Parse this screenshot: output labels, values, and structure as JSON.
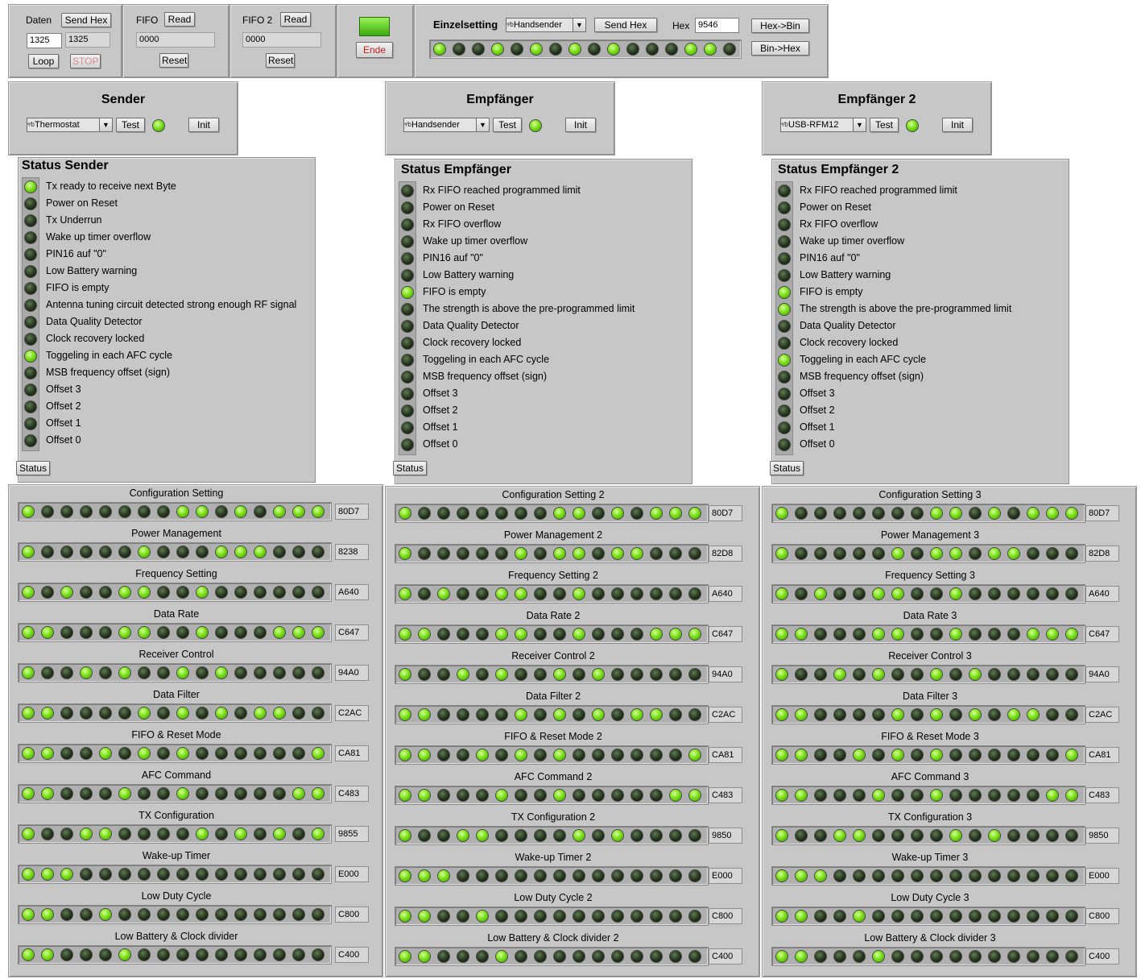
{
  "top": {
    "daten": {
      "label": "Daten",
      "send_hex": "Send Hex",
      "value_in": "1325",
      "value_out": "1325",
      "loop": "Loop",
      "stop": "STOP"
    },
    "fifo": {
      "label": "FIFO",
      "read": "Read",
      "value": "0000",
      "reset": "Reset"
    },
    "fifo2": {
      "label": "FIFO 2",
      "read": "Read",
      "value": "0000",
      "reset": "Reset"
    },
    "ende": "Ende",
    "einzel": {
      "label": "Einzelsetting",
      "combo": "Handsender",
      "send_hex": "Send Hex",
      "hex_label": "Hex",
      "hex_value": "9546",
      "hex_to_bin": "Hex->Bin",
      "bin_to_hex": "Bin->Hex",
      "leds": [
        1,
        0,
        0,
        1,
        0,
        1,
        0,
        1,
        0,
        1,
        0,
        0,
        0,
        1,
        1,
        0
      ]
    }
  },
  "devices": [
    {
      "title": "Sender",
      "combo": "Thermostat",
      "test": "Test",
      "init": "Init",
      "status_title": "Status Sender",
      "status_button": "Status",
      "indicators": [
        {
          "label": "Tx ready to receive next Byte",
          "on": true
        },
        {
          "label": "Power on Reset",
          "on": false
        },
        {
          "label": "Tx Underrun",
          "on": false
        },
        {
          "label": "Wake up timer overflow",
          "on": false
        },
        {
          "label": "PIN16 auf \"0\"",
          "on": false
        },
        {
          "label": "Low Battery warning",
          "on": false
        },
        {
          "label": "FIFO is empty",
          "on": false
        },
        {
          "label": "Antenna tuning circuit detected strong enough RF signal",
          "on": false
        },
        {
          "label": "Data Quality Detector",
          "on": false
        },
        {
          "label": "Clock recovery locked",
          "on": false
        },
        {
          "label": "Toggeling in each AFC cycle",
          "on": true
        },
        {
          "label": "MSB frequency offset (sign)",
          "on": false
        },
        {
          "label": "Offset 3",
          "on": false
        },
        {
          "label": "Offset 2",
          "on": false
        },
        {
          "label": "Offset 1",
          "on": false
        },
        {
          "label": "Offset 0",
          "on": false
        }
      ],
      "configs": [
        {
          "title": "Configuration Setting",
          "hex": "80D7",
          "bits": [
            1,
            0,
            0,
            0,
            0,
            0,
            0,
            0,
            1,
            1,
            0,
            1,
            0,
            1,
            1,
            1
          ]
        },
        {
          "title": "Power Management",
          "hex": "8238",
          "bits": [
            1,
            0,
            0,
            0,
            0,
            0,
            1,
            0,
            0,
            0,
            1,
            1,
            1,
            0,
            0,
            0
          ]
        },
        {
          "title": "Frequency Setting",
          "hex": "A640",
          "bits": [
            1,
            0,
            1,
            0,
            0,
            1,
            1,
            0,
            0,
            1,
            0,
            0,
            0,
            0,
            0,
            0
          ]
        },
        {
          "title": "Data Rate",
          "hex": "C647",
          "bits": [
            1,
            1,
            0,
            0,
            0,
            1,
            1,
            0,
            0,
            1,
            0,
            0,
            0,
            1,
            1,
            1
          ]
        },
        {
          "title": "Receiver Control",
          "hex": "94A0",
          "bits": [
            1,
            0,
            0,
            1,
            0,
            1,
            0,
            0,
            1,
            0,
            1,
            0,
            0,
            0,
            0,
            0
          ]
        },
        {
          "title": "Data Filter",
          "hex": "C2AC",
          "bits": [
            1,
            1,
            0,
            0,
            0,
            0,
            1,
            0,
            1,
            0,
            1,
            0,
            1,
            1,
            0,
            0
          ]
        },
        {
          "title": "FIFO & Reset Mode",
          "hex": "CA81",
          "bits": [
            1,
            1,
            0,
            0,
            1,
            0,
            1,
            0,
            1,
            0,
            0,
            0,
            0,
            0,
            0,
            1
          ]
        },
        {
          "title": "AFC Command",
          "hex": "C483",
          "bits": [
            1,
            1,
            0,
            0,
            0,
            1,
            0,
            0,
            1,
            0,
            0,
            0,
            0,
            0,
            1,
            1
          ]
        },
        {
          "title": "TX Configuration",
          "hex": "9855",
          "bits": [
            1,
            0,
            0,
            1,
            1,
            0,
            0,
            0,
            0,
            1,
            0,
            1,
            0,
            1,
            0,
            1
          ]
        },
        {
          "title": "Wake-up Timer",
          "hex": "E000",
          "bits": [
            1,
            1,
            1,
            0,
            0,
            0,
            0,
            0,
            0,
            0,
            0,
            0,
            0,
            0,
            0,
            0
          ]
        },
        {
          "title": "Low Duty Cycle",
          "hex": "C800",
          "bits": [
            1,
            1,
            0,
            0,
            1,
            0,
            0,
            0,
            0,
            0,
            0,
            0,
            0,
            0,
            0,
            0
          ]
        },
        {
          "title": "Low Battery & Clock divider",
          "hex": "C400",
          "bits": [
            1,
            1,
            0,
            0,
            0,
            1,
            0,
            0,
            0,
            0,
            0,
            0,
            0,
            0,
            0,
            0
          ]
        }
      ]
    },
    {
      "title": "Empfänger",
      "combo": "Handsender",
      "test": "Test",
      "init": "Init",
      "status_title": "Status Empfänger",
      "status_button": "Status",
      "indicators": [
        {
          "label": "Rx FIFO reached programmed limit",
          "on": false
        },
        {
          "label": "Power on Reset",
          "on": false
        },
        {
          "label": "Rx FIFO overflow",
          "on": false
        },
        {
          "label": "Wake up timer overflow",
          "on": false
        },
        {
          "label": "PIN16 auf \"0\"",
          "on": false
        },
        {
          "label": "Low Battery warning",
          "on": false
        },
        {
          "label": "FIFO is empty",
          "on": true
        },
        {
          "label": "The strength is above the pre-programmed limit",
          "on": false
        },
        {
          "label": "Data Quality Detector",
          "on": false
        },
        {
          "label": "Clock recovery locked",
          "on": false
        },
        {
          "label": "Toggeling in each AFC cycle",
          "on": false
        },
        {
          "label": "MSB frequency offset (sign)",
          "on": false
        },
        {
          "label": "Offset 3",
          "on": false
        },
        {
          "label": "Offset 2",
          "on": false
        },
        {
          "label": "Offset 1",
          "on": false
        },
        {
          "label": "Offset 0",
          "on": false
        }
      ],
      "configs": [
        {
          "title": "Configuration Setting 2",
          "hex": "80D7",
          "bits": [
            1,
            0,
            0,
            0,
            0,
            0,
            0,
            0,
            1,
            1,
            0,
            1,
            0,
            1,
            1,
            1
          ]
        },
        {
          "title": "Power Management 2",
          "hex": "82D8",
          "bits": [
            1,
            0,
            0,
            0,
            0,
            0,
            1,
            0,
            1,
            1,
            0,
            1,
            1,
            0,
            0,
            0
          ]
        },
        {
          "title": "Frequency Setting 2",
          "hex": "A640",
          "bits": [
            1,
            0,
            1,
            0,
            0,
            1,
            1,
            0,
            0,
            1,
            0,
            0,
            0,
            0,
            0,
            0
          ]
        },
        {
          "title": "Data Rate 2",
          "hex": "C647",
          "bits": [
            1,
            1,
            0,
            0,
            0,
            1,
            1,
            0,
            0,
            1,
            0,
            0,
            0,
            1,
            1,
            1
          ]
        },
        {
          "title": "Receiver Control 2",
          "hex": "94A0",
          "bits": [
            1,
            0,
            0,
            1,
            0,
            1,
            0,
            0,
            1,
            0,
            1,
            0,
            0,
            0,
            0,
            0
          ]
        },
        {
          "title": "Data Filter 2",
          "hex": "C2AC",
          "bits": [
            1,
            1,
            0,
            0,
            0,
            0,
            1,
            0,
            1,
            0,
            1,
            0,
            1,
            1,
            0,
            0
          ]
        },
        {
          "title": "FIFO & Reset Mode 2",
          "hex": "CA81",
          "bits": [
            1,
            1,
            0,
            0,
            1,
            0,
            1,
            0,
            1,
            0,
            0,
            0,
            0,
            0,
            0,
            1
          ]
        },
        {
          "title": "AFC Command 2",
          "hex": "C483",
          "bits": [
            1,
            1,
            0,
            0,
            0,
            1,
            0,
            0,
            1,
            0,
            0,
            0,
            0,
            0,
            1,
            1
          ]
        },
        {
          "title": "TX Configuration 2",
          "hex": "9850",
          "bits": [
            1,
            0,
            0,
            1,
            1,
            0,
            0,
            0,
            0,
            1,
            0,
            1,
            0,
            0,
            0,
            0
          ]
        },
        {
          "title": "Wake-up Timer 2",
          "hex": "E000",
          "bits": [
            1,
            1,
            1,
            0,
            0,
            0,
            0,
            0,
            0,
            0,
            0,
            0,
            0,
            0,
            0,
            0
          ]
        },
        {
          "title": "Low Duty Cycle 2",
          "hex": "C800",
          "bits": [
            1,
            1,
            0,
            0,
            1,
            0,
            0,
            0,
            0,
            0,
            0,
            0,
            0,
            0,
            0,
            0
          ]
        },
        {
          "title": "Low Battery & Clock divider 2",
          "hex": "C400",
          "bits": [
            1,
            1,
            0,
            0,
            0,
            1,
            0,
            0,
            0,
            0,
            0,
            0,
            0,
            0,
            0,
            0
          ]
        }
      ]
    },
    {
      "title": "Empfänger 2",
      "combo": "USB-RFM12",
      "test": "Test",
      "init": "Init",
      "status_title": "Status Empfänger 2",
      "status_button": "Status",
      "indicators": [
        {
          "label": "Rx FIFO reached programmed limit",
          "on": false
        },
        {
          "label": "Power on Reset",
          "on": false
        },
        {
          "label": "Rx FIFO overflow",
          "on": false
        },
        {
          "label": "Wake up timer overflow",
          "on": false
        },
        {
          "label": "PIN16 auf \"0\"",
          "on": false
        },
        {
          "label": "Low Battery warning",
          "on": false
        },
        {
          "label": "FIFO is empty",
          "on": true
        },
        {
          "label": "The strength is above the pre-programmed limit",
          "on": true
        },
        {
          "label": "Data Quality Detector",
          "on": false
        },
        {
          "label": "Clock recovery locked",
          "on": false
        },
        {
          "label": "Toggeling in each AFC cycle",
          "on": true
        },
        {
          "label": "MSB frequency offset (sign)",
          "on": false
        },
        {
          "label": "Offset 3",
          "on": false
        },
        {
          "label": "Offset 2",
          "on": false
        },
        {
          "label": "Offset 1",
          "on": false
        },
        {
          "label": "Offset 0",
          "on": false
        }
      ],
      "configs": [
        {
          "title": "Configuration Setting 3",
          "hex": "80D7",
          "bits": [
            1,
            0,
            0,
            0,
            0,
            0,
            0,
            0,
            1,
            1,
            0,
            1,
            0,
            1,
            1,
            1
          ]
        },
        {
          "title": "Power Management 3",
          "hex": "82D8",
          "bits": [
            1,
            0,
            0,
            0,
            0,
            0,
            1,
            0,
            1,
            1,
            0,
            1,
            1,
            0,
            0,
            0
          ]
        },
        {
          "title": "Frequency Setting 3",
          "hex": "A640",
          "bits": [
            1,
            0,
            1,
            0,
            0,
            1,
            1,
            0,
            0,
            1,
            0,
            0,
            0,
            0,
            0,
            0
          ]
        },
        {
          "title": "Data Rate 3",
          "hex": "C647",
          "bits": [
            1,
            1,
            0,
            0,
            0,
            1,
            1,
            0,
            0,
            1,
            0,
            0,
            0,
            1,
            1,
            1
          ]
        },
        {
          "title": "Receiver Control 3",
          "hex": "94A0",
          "bits": [
            1,
            0,
            0,
            1,
            0,
            1,
            0,
            0,
            1,
            0,
            1,
            0,
            0,
            0,
            0,
            0
          ]
        },
        {
          "title": "Data Filter 3",
          "hex": "C2AC",
          "bits": [
            1,
            1,
            0,
            0,
            0,
            0,
            1,
            0,
            1,
            0,
            1,
            0,
            1,
            1,
            0,
            0
          ]
        },
        {
          "title": "FIFO & Reset Mode 3",
          "hex": "CA81",
          "bits": [
            1,
            1,
            0,
            0,
            1,
            0,
            1,
            0,
            1,
            0,
            0,
            0,
            0,
            0,
            0,
            1
          ]
        },
        {
          "title": "AFC Command 3",
          "hex": "C483",
          "bits": [
            1,
            1,
            0,
            0,
            0,
            1,
            0,
            0,
            1,
            0,
            0,
            0,
            0,
            0,
            1,
            1
          ]
        },
        {
          "title": "TX Configuration 3",
          "hex": "9850",
          "bits": [
            1,
            0,
            0,
            1,
            1,
            0,
            0,
            0,
            0,
            1,
            0,
            1,
            0,
            0,
            0,
            0
          ]
        },
        {
          "title": "Wake-up Timer 3",
          "hex": "E000",
          "bits": [
            1,
            1,
            1,
            0,
            0,
            0,
            0,
            0,
            0,
            0,
            0,
            0,
            0,
            0,
            0,
            0
          ]
        },
        {
          "title": "Low Duty Cycle 3",
          "hex": "C800",
          "bits": [
            1,
            1,
            0,
            0,
            1,
            0,
            0,
            0,
            0,
            0,
            0,
            0,
            0,
            0,
            0,
            0
          ]
        },
        {
          "title": "Low Battery & Clock divider 3",
          "hex": "C400",
          "bits": [
            1,
            1,
            0,
            0,
            0,
            1,
            0,
            0,
            0,
            0,
            0,
            0,
            0,
            0,
            0,
            0
          ]
        }
      ]
    }
  ]
}
